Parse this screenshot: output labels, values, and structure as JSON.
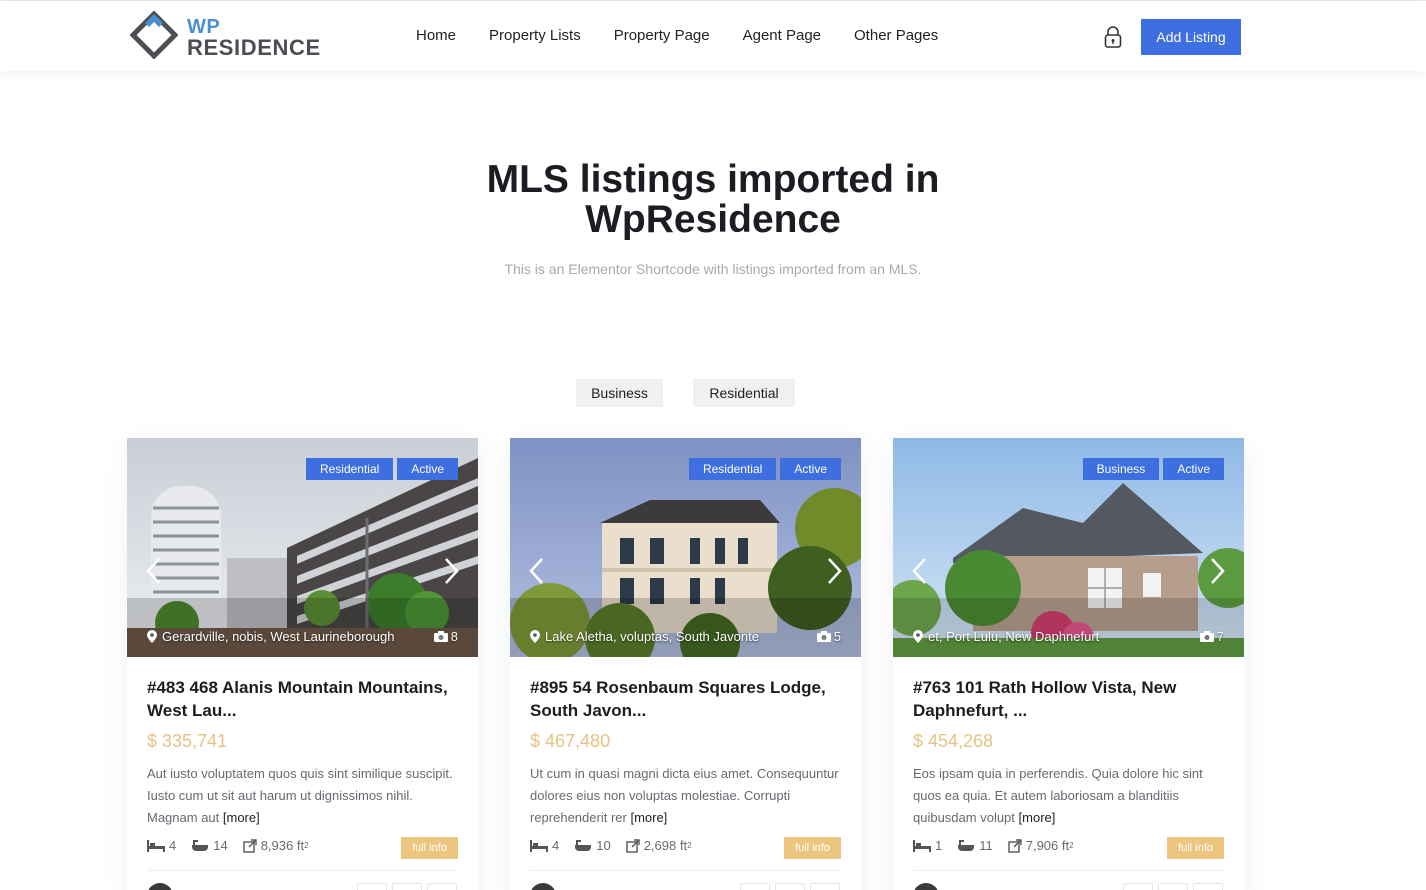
{
  "header": {
    "logo_wp": "WP",
    "logo_residence": "RESIDENCE",
    "nav": [
      "Home",
      "Property Lists",
      "Property Page",
      "Agent Page",
      "Other Pages"
    ],
    "add_listing": "Add Listing"
  },
  "hero": {
    "title_line1": "MLS listings imported in",
    "title_line2": "WpResidence",
    "subtitle": "This is an Elementor Shortcode with listings imported from an MLS."
  },
  "filters": [
    "Business",
    "Residential"
  ],
  "accent_color": "#3e6fe0",
  "price_color": "#e6c382",
  "cards": [
    {
      "type_badge": "Residential",
      "status_badge": "Active",
      "location": "Gerardville, nobis, West Laurineborough",
      "photo_count": "8",
      "title": "#483 468 Alanis Mountain Mountains, West Lau...",
      "price": "$ 335,741",
      "description": "Aut iusto voluptatem quos quis sint similique suscipit. Iusto cum ut sit aut harum ut dignissimos nihil. Magnam aut",
      "more": "[more]",
      "beds": "4",
      "baths": "14",
      "size": "8,936 ft",
      "size_unit_exp": "2",
      "full_info": "full info"
    },
    {
      "type_badge": "Residential",
      "status_badge": "Active",
      "location": "Lake Aletha, voluptas, South Javonte",
      "photo_count": "5",
      "title": "#895 54 Rosenbaum Squares Lodge, South Javon...",
      "price": "$ 467,480",
      "description": "Ut cum in quasi magni dicta eius amet. Consequuntur dolores eius non voluptas molestiae. Corrupti reprehenderit rer",
      "more": "[more]",
      "beds": "4",
      "baths": "10",
      "size": "2,698 ft",
      "size_unit_exp": "2",
      "full_info": "full info"
    },
    {
      "type_badge": "Business",
      "status_badge": "Active",
      "location": "et, Port Lulu, New Daphnefurt",
      "photo_count": "7",
      "title": "#763 101 Rath Hollow Vista, New Daphnefurt, ...",
      "price": "$ 454,268",
      "description": "Eos ipsam quia in perferendis. Quia dolore hic sint quos ea quia. Et autem laboriosam a blanditiis quibusdam volupt",
      "more": "[more]",
      "beds": "1",
      "baths": "11",
      "size": "7,906 ft",
      "size_unit_exp": "2",
      "full_info": "full info"
    }
  ]
}
